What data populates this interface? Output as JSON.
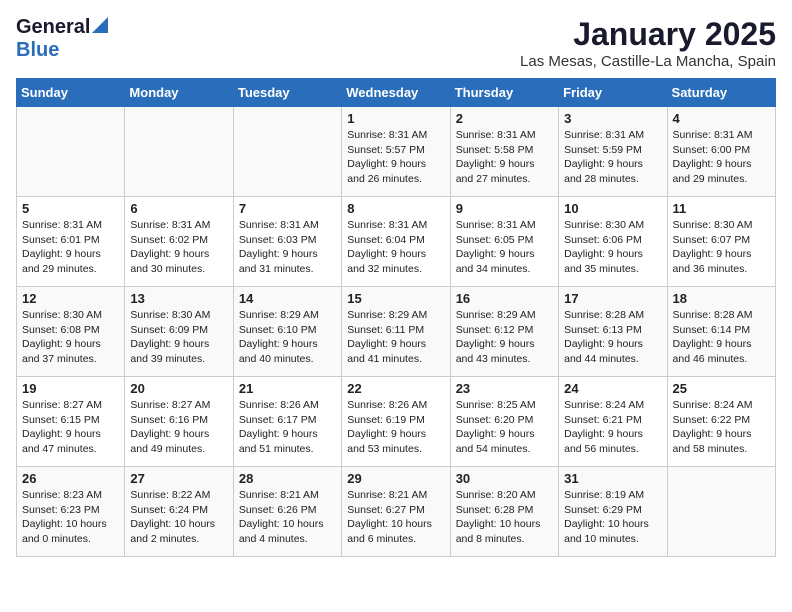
{
  "header": {
    "logo_general": "General",
    "logo_blue": "Blue",
    "title": "January 2025",
    "location": "Las Mesas, Castille-La Mancha, Spain"
  },
  "days_of_week": [
    "Sunday",
    "Monday",
    "Tuesday",
    "Wednesday",
    "Thursday",
    "Friday",
    "Saturday"
  ],
  "weeks": [
    [
      {
        "day": "",
        "text": ""
      },
      {
        "day": "",
        "text": ""
      },
      {
        "day": "",
        "text": ""
      },
      {
        "day": "1",
        "text": "Sunrise: 8:31 AM\nSunset: 5:57 PM\nDaylight: 9 hours and 26 minutes."
      },
      {
        "day": "2",
        "text": "Sunrise: 8:31 AM\nSunset: 5:58 PM\nDaylight: 9 hours and 27 minutes."
      },
      {
        "day": "3",
        "text": "Sunrise: 8:31 AM\nSunset: 5:59 PM\nDaylight: 9 hours and 28 minutes."
      },
      {
        "day": "4",
        "text": "Sunrise: 8:31 AM\nSunset: 6:00 PM\nDaylight: 9 hours and 29 minutes."
      }
    ],
    [
      {
        "day": "5",
        "text": "Sunrise: 8:31 AM\nSunset: 6:01 PM\nDaylight: 9 hours and 29 minutes."
      },
      {
        "day": "6",
        "text": "Sunrise: 8:31 AM\nSunset: 6:02 PM\nDaylight: 9 hours and 30 minutes."
      },
      {
        "day": "7",
        "text": "Sunrise: 8:31 AM\nSunset: 6:03 PM\nDaylight: 9 hours and 31 minutes."
      },
      {
        "day": "8",
        "text": "Sunrise: 8:31 AM\nSunset: 6:04 PM\nDaylight: 9 hours and 32 minutes."
      },
      {
        "day": "9",
        "text": "Sunrise: 8:31 AM\nSunset: 6:05 PM\nDaylight: 9 hours and 34 minutes."
      },
      {
        "day": "10",
        "text": "Sunrise: 8:30 AM\nSunset: 6:06 PM\nDaylight: 9 hours and 35 minutes."
      },
      {
        "day": "11",
        "text": "Sunrise: 8:30 AM\nSunset: 6:07 PM\nDaylight: 9 hours and 36 minutes."
      }
    ],
    [
      {
        "day": "12",
        "text": "Sunrise: 8:30 AM\nSunset: 6:08 PM\nDaylight: 9 hours and 37 minutes."
      },
      {
        "day": "13",
        "text": "Sunrise: 8:30 AM\nSunset: 6:09 PM\nDaylight: 9 hours and 39 minutes."
      },
      {
        "day": "14",
        "text": "Sunrise: 8:29 AM\nSunset: 6:10 PM\nDaylight: 9 hours and 40 minutes."
      },
      {
        "day": "15",
        "text": "Sunrise: 8:29 AM\nSunset: 6:11 PM\nDaylight: 9 hours and 41 minutes."
      },
      {
        "day": "16",
        "text": "Sunrise: 8:29 AM\nSunset: 6:12 PM\nDaylight: 9 hours and 43 minutes."
      },
      {
        "day": "17",
        "text": "Sunrise: 8:28 AM\nSunset: 6:13 PM\nDaylight: 9 hours and 44 minutes."
      },
      {
        "day": "18",
        "text": "Sunrise: 8:28 AM\nSunset: 6:14 PM\nDaylight: 9 hours and 46 minutes."
      }
    ],
    [
      {
        "day": "19",
        "text": "Sunrise: 8:27 AM\nSunset: 6:15 PM\nDaylight: 9 hours and 47 minutes."
      },
      {
        "day": "20",
        "text": "Sunrise: 8:27 AM\nSunset: 6:16 PM\nDaylight: 9 hours and 49 minutes."
      },
      {
        "day": "21",
        "text": "Sunrise: 8:26 AM\nSunset: 6:17 PM\nDaylight: 9 hours and 51 minutes."
      },
      {
        "day": "22",
        "text": "Sunrise: 8:26 AM\nSunset: 6:19 PM\nDaylight: 9 hours and 53 minutes."
      },
      {
        "day": "23",
        "text": "Sunrise: 8:25 AM\nSunset: 6:20 PM\nDaylight: 9 hours and 54 minutes."
      },
      {
        "day": "24",
        "text": "Sunrise: 8:24 AM\nSunset: 6:21 PM\nDaylight: 9 hours and 56 minutes."
      },
      {
        "day": "25",
        "text": "Sunrise: 8:24 AM\nSunset: 6:22 PM\nDaylight: 9 hours and 58 minutes."
      }
    ],
    [
      {
        "day": "26",
        "text": "Sunrise: 8:23 AM\nSunset: 6:23 PM\nDaylight: 10 hours and 0 minutes."
      },
      {
        "day": "27",
        "text": "Sunrise: 8:22 AM\nSunset: 6:24 PM\nDaylight: 10 hours and 2 minutes."
      },
      {
        "day": "28",
        "text": "Sunrise: 8:21 AM\nSunset: 6:26 PM\nDaylight: 10 hours and 4 minutes."
      },
      {
        "day": "29",
        "text": "Sunrise: 8:21 AM\nSunset: 6:27 PM\nDaylight: 10 hours and 6 minutes."
      },
      {
        "day": "30",
        "text": "Sunrise: 8:20 AM\nSunset: 6:28 PM\nDaylight: 10 hours and 8 minutes."
      },
      {
        "day": "31",
        "text": "Sunrise: 8:19 AM\nSunset: 6:29 PM\nDaylight: 10 hours and 10 minutes."
      },
      {
        "day": "",
        "text": ""
      }
    ]
  ]
}
